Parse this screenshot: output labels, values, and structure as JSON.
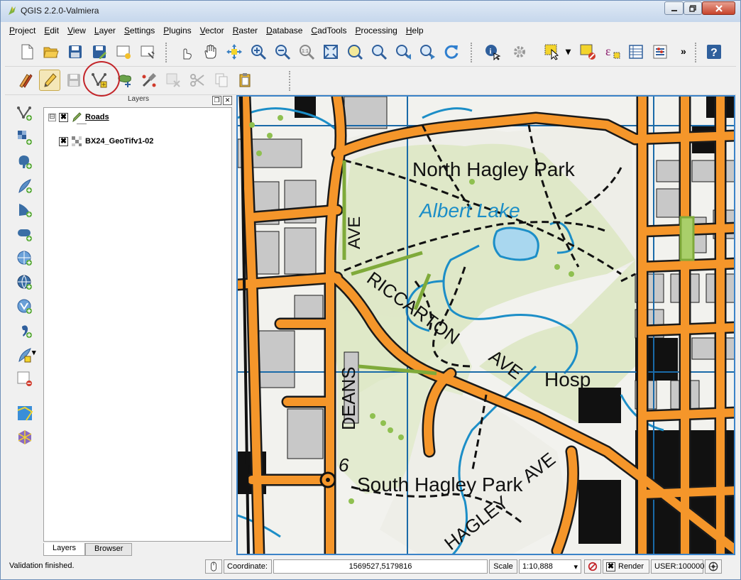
{
  "window": {
    "title": "QGIS 2.2.0-Valmiera"
  },
  "menu": [
    {
      "label": "Project",
      "u": "P",
      "rest": "roject"
    },
    {
      "label": "Edit",
      "u": "E",
      "rest": "dit"
    },
    {
      "label": "View",
      "u": "V",
      "rest": "iew"
    },
    {
      "label": "Layer",
      "u": "L",
      "rest": "ayer"
    },
    {
      "label": "Settings",
      "u": "S",
      "rest": "ettings"
    },
    {
      "label": "Plugins",
      "u": "P",
      "rest": "lugins"
    },
    {
      "label": "Vector",
      "u": "V",
      "rest": "ector"
    },
    {
      "label": "Raster",
      "u": "R",
      "rest": "aster"
    },
    {
      "label": "Database",
      "u": "D",
      "rest": "atabase"
    },
    {
      "label": "CadTools",
      "u": "C",
      "rest": "adTools"
    },
    {
      "label": "Processing",
      "u": "P",
      "rest": "rocessing"
    },
    {
      "label": "Help",
      "u": "H",
      "rest": "elp"
    }
  ],
  "toolbar": {
    "overflow_glyph": "»"
  },
  "layers_panel": {
    "title": "Layers",
    "layers": [
      {
        "name": "Roads",
        "checked": "✖",
        "current": true
      },
      {
        "name": "BX24_GeoTifv1-02",
        "checked": "✖",
        "current": false
      }
    ],
    "expander_glyph": "⊟",
    "tabs": [
      "Layers",
      "Browser"
    ]
  },
  "map_labels": {
    "north_hagley": "North Hagley Park",
    "albert_lake": "Albert Lake",
    "riccarton": "RICCARTON",
    "ave1": "AVE",
    "ave2": "AVE",
    "ave3": "AVE",
    "deans": "DEANS",
    "hosp": "Hosp",
    "south_hagley": "South Hagley Park",
    "hagley": "HAGLEY",
    "six": "6"
  },
  "statusbar": {
    "message": "Validation finished.",
    "coordinate_label": "Coordinate:",
    "coordinate_value": "1569527,5179816",
    "scale_label": "Scale",
    "scale_value": "1:10,888",
    "render_label": "Render",
    "render_checked": "✖",
    "crs": "USER:100000"
  },
  "colors": {
    "road_fill": "#f5962a",
    "road_edge": "#1a1a1a",
    "park": "#dfe8c8",
    "water": "#1c8ec7",
    "building": "#c8c8c8",
    "accent": "#3b83c8",
    "highlight": "#c3252a"
  }
}
